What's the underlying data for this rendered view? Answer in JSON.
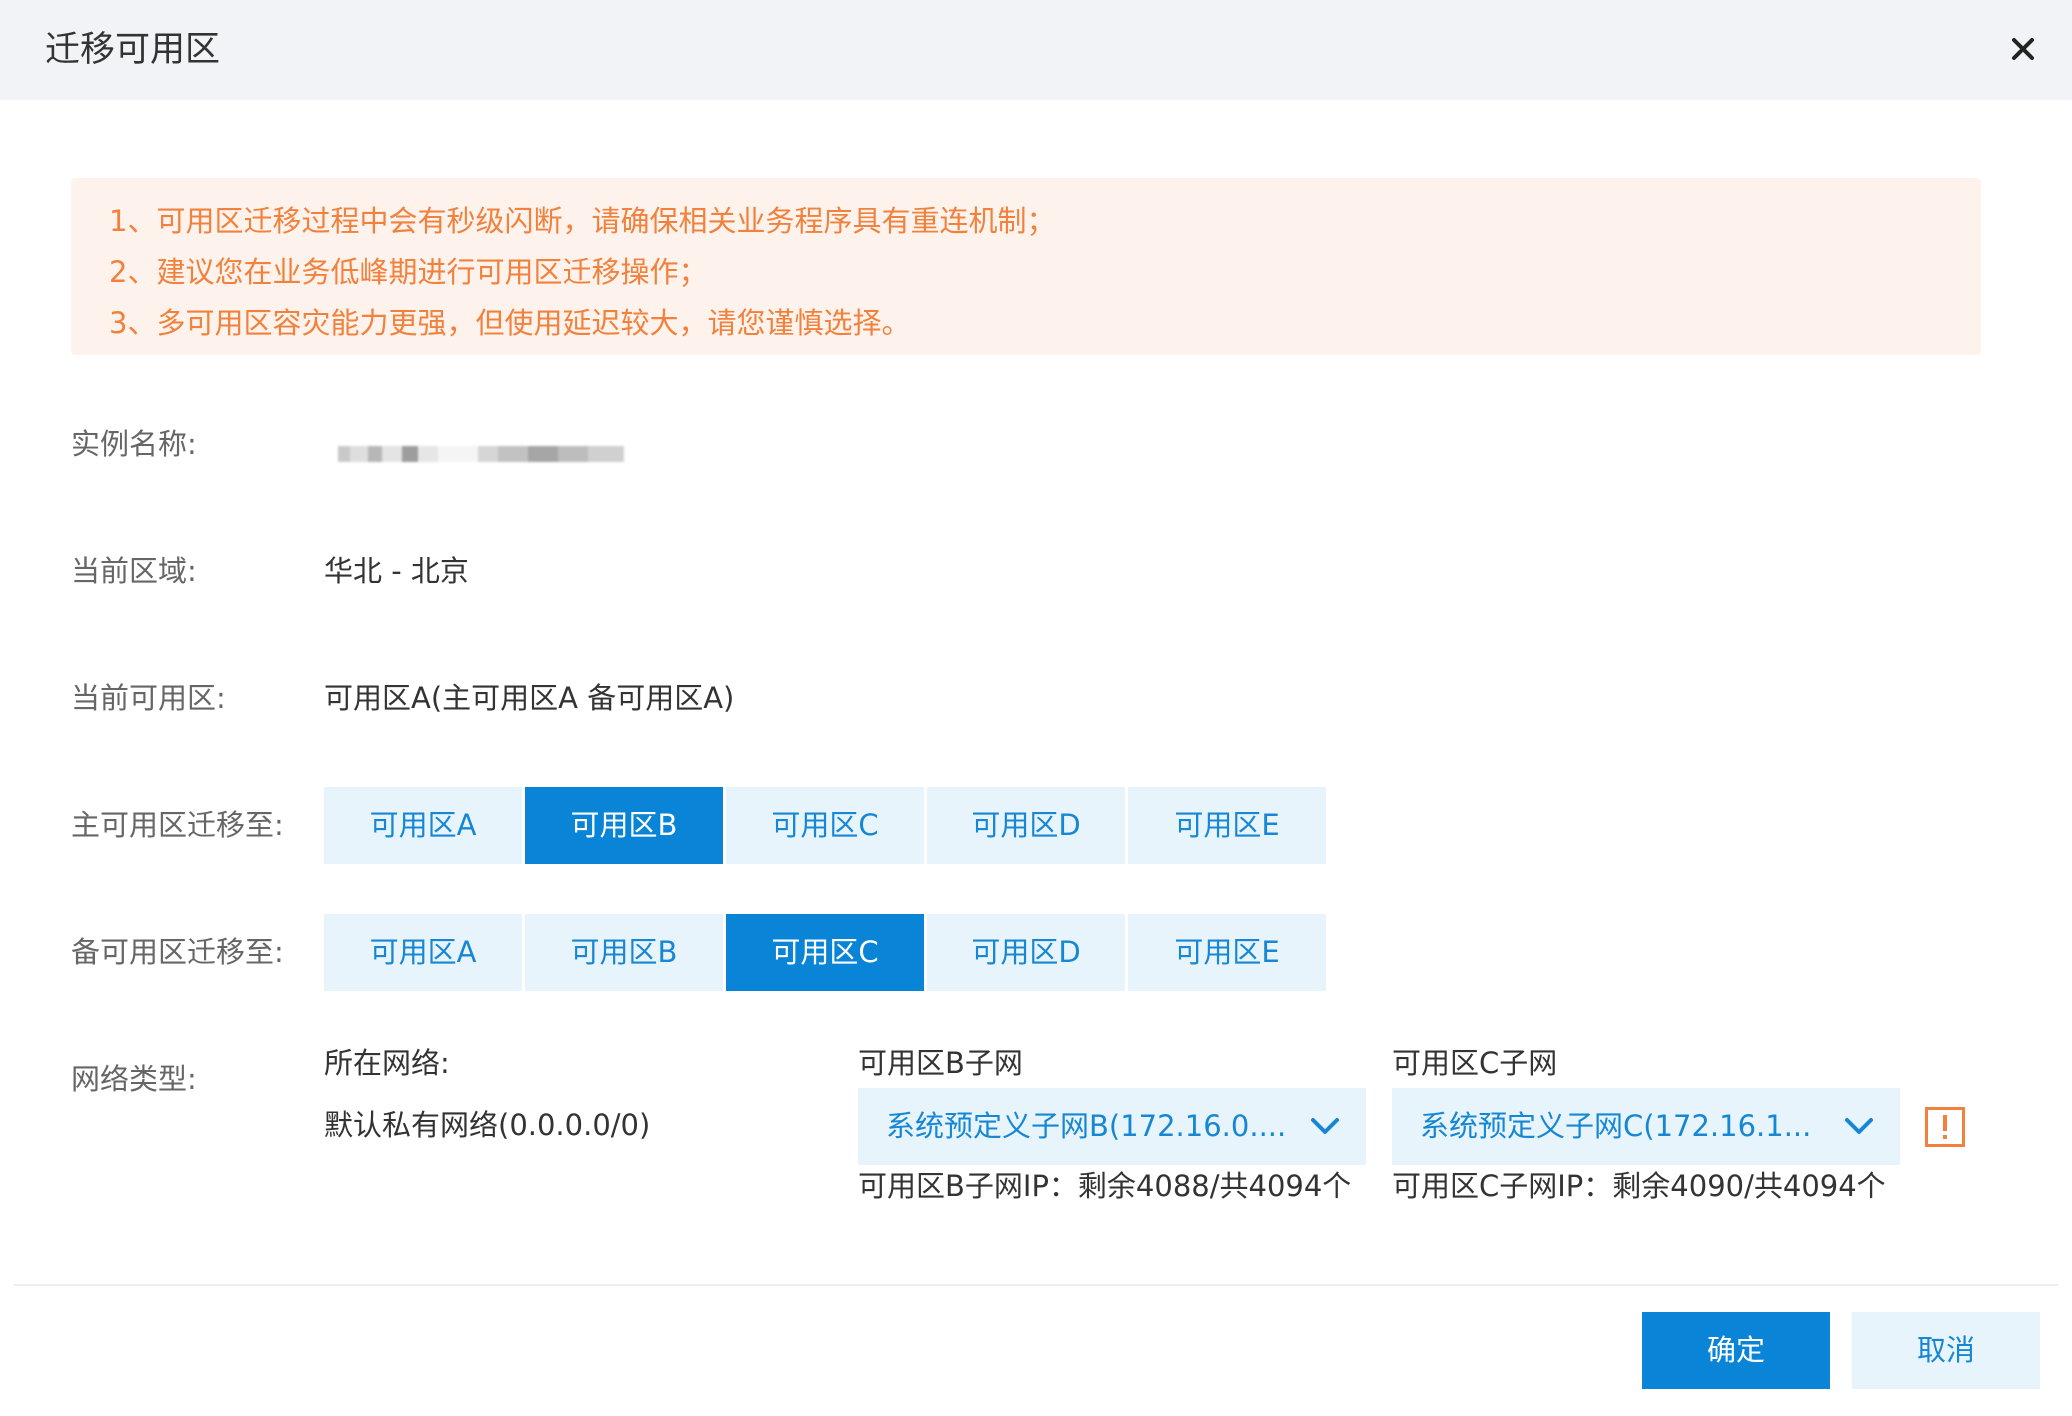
{
  "dialog": {
    "title": "迁移可用区",
    "close_icon": "close-icon"
  },
  "notice": {
    "lines": [
      "1、可用区迁移过程中会有秒级闪断，请确保相关业务程序具有重连机制；",
      "2、建议您在业务低峰期进行可用区迁移操作；",
      "3、多可用区容灾能力更强，但使用延迟较大，请您谨慎选择。"
    ]
  },
  "form": {
    "instance_name_label": "实例名称:",
    "region_label": "当前区域:",
    "region_value": "华北 - 北京",
    "current_zone_label": "当前可用区:",
    "current_zone_value": "可用区A(主可用区A 备可用区A)",
    "primary_label": "主可用区迁移至:",
    "primary_options": [
      "可用区A",
      "可用区B",
      "可用区C",
      "可用区D",
      "可用区E"
    ],
    "primary_selected": "可用区B",
    "backup_label": "备可用区迁移至:",
    "backup_options": [
      "可用区A",
      "可用区B",
      "可用区C",
      "可用区D",
      "可用区E"
    ],
    "backup_selected": "可用区C",
    "network_label": "网络类型:",
    "network_heading": "所在网络:",
    "network_value": "默认私有网络(0.0.0.0/0)",
    "subnet_b": {
      "heading": "可用区B子网",
      "selected": "系统预定义子网B(172.16.0....",
      "ip_info": "可用区B子网IP：剩余4088/共4094个"
    },
    "subnet_c": {
      "heading": "可用区C子网",
      "selected": "系统预定义子网C(172.16.1...",
      "ip_info": "可用区C子网IP：剩余4090/共4094个"
    },
    "warning_icon": "warning-icon"
  },
  "footer": {
    "confirm_label": "确定",
    "cancel_label": "取消"
  },
  "colors": {
    "accent": "#0a84d6",
    "accent_light": "#e7f4fb",
    "notice_text": "#f1813c",
    "notice_bg": "#fdf3ec"
  }
}
